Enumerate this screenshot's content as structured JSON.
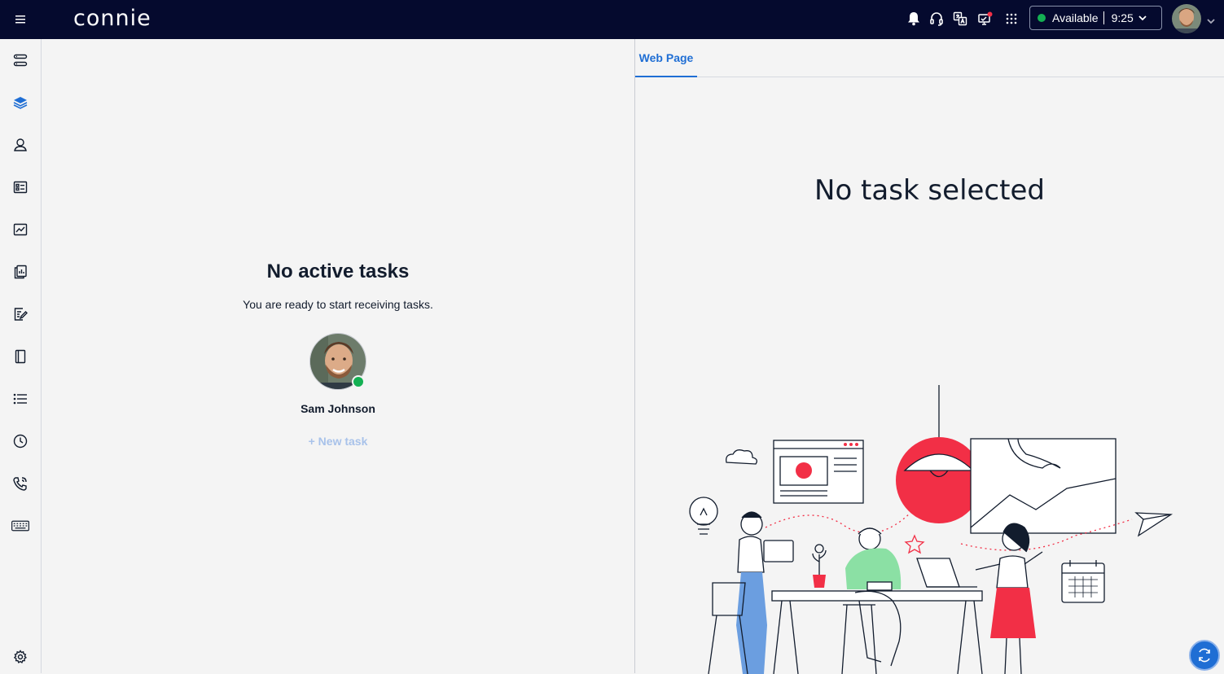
{
  "header": {
    "logo_text": "connie",
    "status": {
      "label": "Available",
      "time": "9:25"
    }
  },
  "left_panel": {
    "title": "No active tasks",
    "subtitle": "You are ready to start receiving tasks.",
    "user_name": "Sam Johnson",
    "new_task_label": "+ New task"
  },
  "right_panel": {
    "tab_label": "Web Page",
    "empty_title": "No task selected"
  },
  "colors": {
    "topbar": "#050a2e",
    "accent": "#1f6ed4",
    "online": "#14b053",
    "illustration_red": "#f22f46",
    "illustration_green": "#8be0a4",
    "illustration_blue": "#6b9ee0"
  }
}
